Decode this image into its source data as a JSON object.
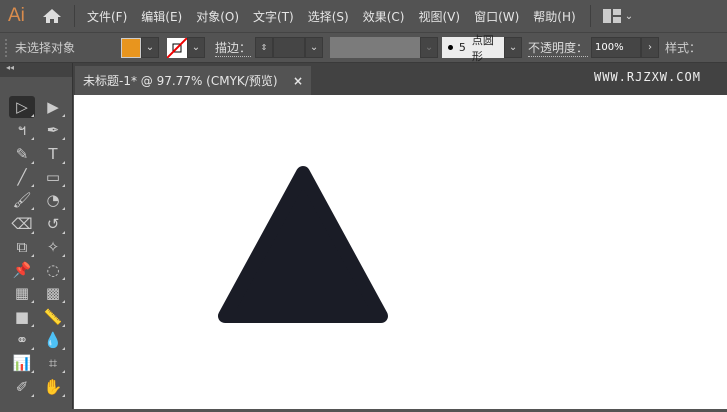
{
  "app": {
    "logo": "Ai"
  },
  "menu": [
    "文件(F)",
    "编辑(E)",
    "对象(O)",
    "文字(T)",
    "选择(S)",
    "效果(C)",
    "视图(V)",
    "窗口(W)",
    "帮助(H)"
  ],
  "control": {
    "selection": "未选择对象",
    "stroke_label": "描边：",
    "brush_value": "5",
    "brush_label": "点圆形",
    "opacity_label": "不透明度：",
    "opacity_value": "100%",
    "style_label": "样式：",
    "fill_color": "#E8951E"
  },
  "document": {
    "tab_title": "未标题-1* @ 97.77% (CMYK/预览)",
    "close": "×"
  },
  "watermark": "WWW.RJZXW.COM",
  "tools": [
    "selection-tool",
    "direct-selection-tool",
    "lasso-tool",
    "pen-tool",
    "curvature-tool",
    "type-tool",
    "line-tool",
    "rectangle-tool",
    "paintbrush-tool",
    "shaper-tool",
    "eraser-tool",
    "rotate-tool",
    "scale-tool",
    "puppet-warp-tool",
    "pin-tool",
    "shape-builder-tool",
    "perspective-grid-tool",
    "mesh-tool",
    "gradient-tool",
    "measure-tool",
    "blend-tool",
    "eyedropper-tool",
    "graph-tool",
    "artboard-tool",
    "pencil-tool",
    "hand-tool"
  ],
  "tool_glyphs": [
    "▷",
    "▶",
    "ฯ",
    "✒",
    "✎",
    "T",
    "╱",
    "▭",
    "🖌",
    "◔",
    "⌫",
    "↺",
    "⧉",
    "✧",
    "📌",
    "◌",
    "▦",
    "▩",
    "■",
    "📏",
    "⚭",
    "💧",
    "📊",
    "⌗",
    "✐",
    "✋"
  ],
  "shape": {
    "type": "rounded-triangle",
    "color": "#1A1C26"
  }
}
